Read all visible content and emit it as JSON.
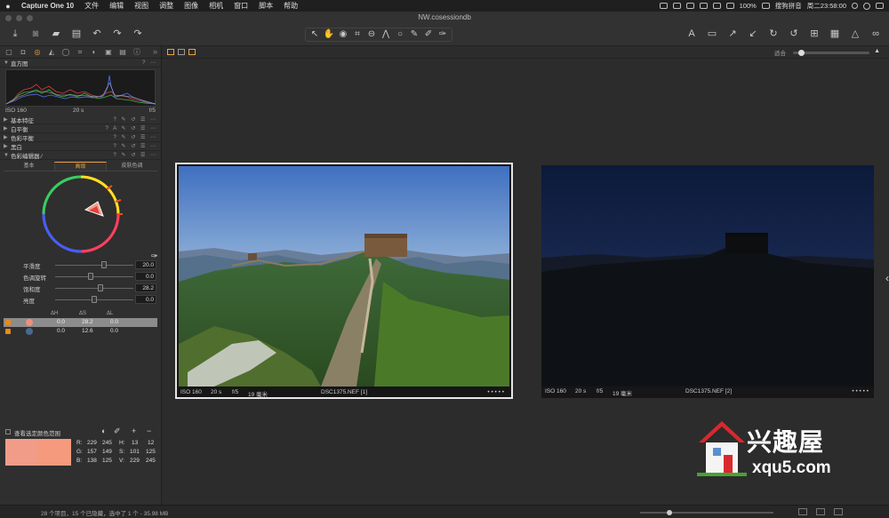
{
  "menubar": {
    "apple": "",
    "items": [
      "Capture One 10",
      "文件",
      "编辑",
      "视图",
      "调整",
      "图像",
      "相机",
      "窗口",
      "脚本",
      "帮助"
    ],
    "battery": "100%",
    "ime": "搜狗拼音",
    "clock": "周二23:58:00"
  },
  "title": {
    "document": "NW.cosessiondb"
  },
  "left_panel": {
    "histogram": {
      "title": "直方图",
      "iso": "ISO 160",
      "shutter": "20 s",
      "aperture": "f/5"
    },
    "sections": [
      {
        "label": "基本特征"
      },
      {
        "label": "白平衡"
      },
      {
        "label": "色彩平衡"
      },
      {
        "label": "黑白"
      },
      {
        "label": "色彩编辑器 ⁄"
      }
    ],
    "subtabs": [
      "基本",
      "高级",
      "皮肤色调"
    ],
    "sliders": [
      {
        "label": "平滑度",
        "value": "20.0",
        "pos": 0.62
      },
      {
        "label": "色调旋转",
        "value": "0.0",
        "pos": 0.45
      },
      {
        "label": "饱和度",
        "value": "28.2",
        "pos": 0.58
      },
      {
        "label": "亮度",
        "value": "0.0",
        "pos": 0.5
      }
    ],
    "range_headers": [
      "ΔH",
      "ΔS",
      "ΔL"
    ],
    "ranges": [
      {
        "h": "0.0",
        "s": "28.2",
        "l": "0.0",
        "color": "#f08f79"
      },
      {
        "h": "0.0",
        "s": "12.6",
        "l": "0.0",
        "color": "#4a6a8a"
      }
    ],
    "show_range_label": "查看选定颜色范围",
    "swatch_colors": [
      "#f09c89",
      "#f59a7d"
    ],
    "readout": {
      "row1": [
        "R:",
        "229",
        "245",
        "H:",
        "13",
        "12"
      ],
      "row2": [
        "G:",
        "157",
        "149",
        "S:",
        "101",
        "125"
      ],
      "row3": [
        "B:",
        "138",
        "125",
        "V:",
        "229",
        "245"
      ]
    }
  },
  "viewer": {
    "zoom_label": "适合",
    "photos": [
      {
        "iso": "ISO 160",
        "shutter": "20 s",
        "aperture": "f/5",
        "focal": "19 毫米",
        "filename": "DSC1375.NEF [1]",
        "dots": "• • • • •"
      },
      {
        "iso": "ISO 160",
        "shutter": "20 s",
        "aperture": "f/5",
        "focal": "19 毫米",
        "filename": "DSC1375.NEF [2]",
        "dots": "• • • • •"
      }
    ]
  },
  "watermark": {
    "cn": "兴趣屋",
    "url": "xqu5.com"
  },
  "status": {
    "text": "28 个项目，15 个已隐藏，选中了 1 个 - 35.98 MB"
  },
  "icons": [
    "import-icon",
    "camera-icon",
    "folder-icon",
    "trash-icon",
    "undo-icon",
    "redo-icon",
    "cursor-icon",
    "hand-icon",
    "crop-icon",
    "text-icon",
    "rotate-icon",
    "grid-icon",
    "warning-icon",
    "glasses-icon"
  ]
}
